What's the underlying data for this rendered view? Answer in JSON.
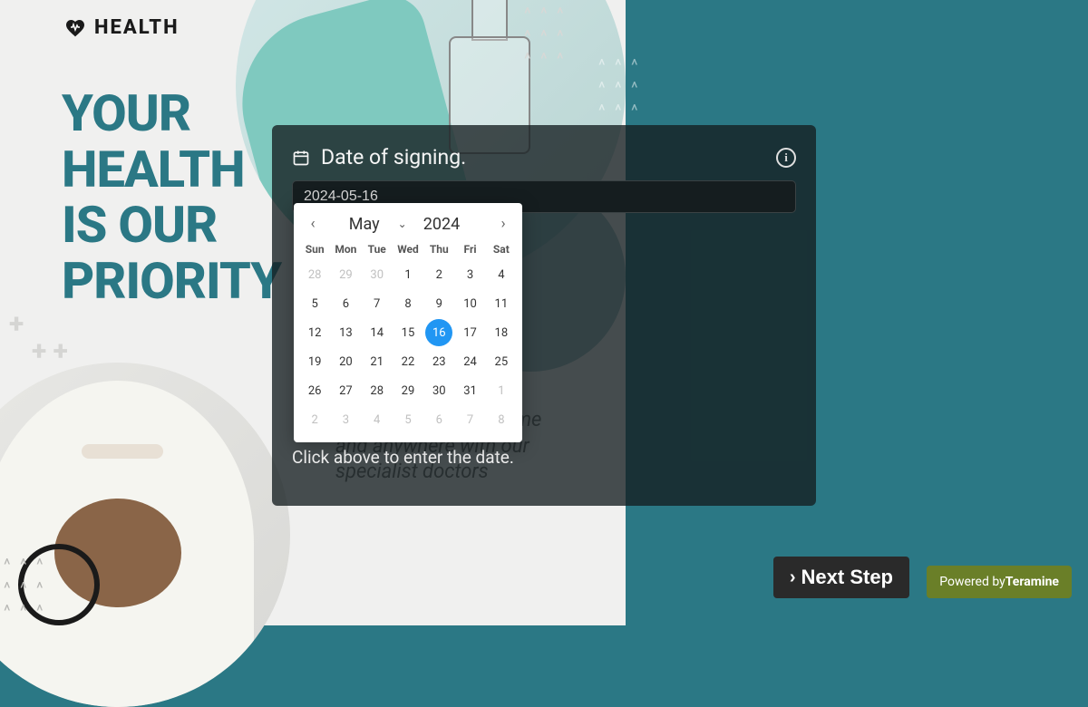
{
  "logo": {
    "text": "HEALTH"
  },
  "headline": {
    "line1": "YOUR",
    "line2": "HEALTH",
    "line3": "IS OUR",
    "line4": "PRIORITY"
  },
  "subtext": {
    "line1": "Ask your health anytime",
    "line2": "and anywhere with our",
    "line3": "specialist doctors"
  },
  "modal": {
    "title": "Date of signing.",
    "input_value": "2024-05-16",
    "hint": "Click above to enter the date."
  },
  "calendar": {
    "month": "May",
    "year": "2024",
    "weekdays": [
      "Sun",
      "Mon",
      "Tue",
      "Wed",
      "Thu",
      "Fri",
      "Sat"
    ],
    "selected_day": "16",
    "weeks": [
      [
        {
          "d": "28",
          "o": true
        },
        {
          "d": "29",
          "o": true
        },
        {
          "d": "30",
          "o": true
        },
        {
          "d": "1"
        },
        {
          "d": "2"
        },
        {
          "d": "3"
        },
        {
          "d": "4"
        }
      ],
      [
        {
          "d": "5"
        },
        {
          "d": "6"
        },
        {
          "d": "7"
        },
        {
          "d": "8"
        },
        {
          "d": "9"
        },
        {
          "d": "10"
        },
        {
          "d": "11"
        }
      ],
      [
        {
          "d": "12"
        },
        {
          "d": "13"
        },
        {
          "d": "14"
        },
        {
          "d": "15"
        },
        {
          "d": "16",
          "sel": true
        },
        {
          "d": "17"
        },
        {
          "d": "18"
        }
      ],
      [
        {
          "d": "19"
        },
        {
          "d": "20"
        },
        {
          "d": "21"
        },
        {
          "d": "22"
        },
        {
          "d": "23"
        },
        {
          "d": "24"
        },
        {
          "d": "25"
        }
      ],
      [
        {
          "d": "26"
        },
        {
          "d": "27"
        },
        {
          "d": "28"
        },
        {
          "d": "29"
        },
        {
          "d": "30"
        },
        {
          "d": "31"
        },
        {
          "d": "1",
          "o": true
        }
      ],
      [
        {
          "d": "2",
          "o": true
        },
        {
          "d": "3",
          "o": true
        },
        {
          "d": "4",
          "o": true
        },
        {
          "d": "5",
          "o": true
        },
        {
          "d": "6",
          "o": true
        },
        {
          "d": "7",
          "o": true
        },
        {
          "d": "8",
          "o": true
        }
      ]
    ]
  },
  "footer": {
    "next_label": "Next Step",
    "powered_prefix": "Powered by",
    "powered_brand": "Teramine"
  }
}
